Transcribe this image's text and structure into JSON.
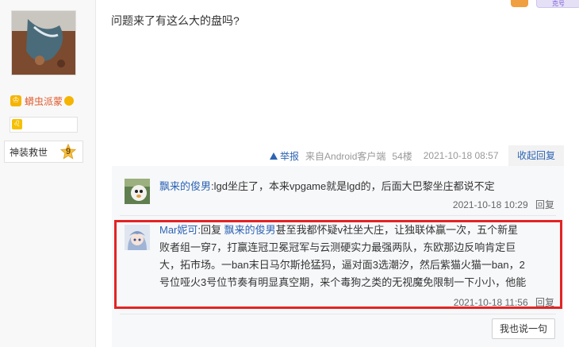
{
  "topbar": {
    "tag_label": "克号"
  },
  "author": {
    "name": "蟒虫派蒙",
    "level_title": "神装救世",
    "level_number": "9"
  },
  "post": {
    "content": "问题来了有这么大的盘吗?",
    "report_label": "举报",
    "source": "来自Android客户端",
    "floor": "54楼",
    "time": "2021-10-18 08:57",
    "collapse_label": "收起回复"
  },
  "replies": [
    {
      "user": "飘来的俊男",
      "separator": ":",
      "text": "lgd坐庄了，本来vpgame就是lgd的，后面大巴黎坐庄都说不定",
      "time": "2021-10-18 10:29",
      "reply_label": "回复"
    },
    {
      "user": "Mar妮可",
      "separator": ":",
      "reply_prefix": "回复",
      "reply_to": "飘来的俊男",
      "line1": "甚至我都怀疑v社坐大庄，让独联体赢一次，五个新星",
      "line2": "败者组一穿7，打赢连冠卫冕冠军与云测硬实力最强两队，东欧那边反响肯定巨",
      "line3": "大，拓市场。一ban末日马尔斯抢猛犸，逼对面3选潮汐，然后紫猫火猫一ban，2",
      "line4": "号位哑火3号位节奏有明显真空期，来个毒狗之类的无视魔免限制一下小小，他能",
      "time": "2021-10-18 11:56",
      "reply_label": "回复"
    }
  ],
  "say_button": "我也说一句",
  "colors": {
    "link": "#2d64b3",
    "highlight": "#e32424",
    "username": "#e05a2c"
  }
}
